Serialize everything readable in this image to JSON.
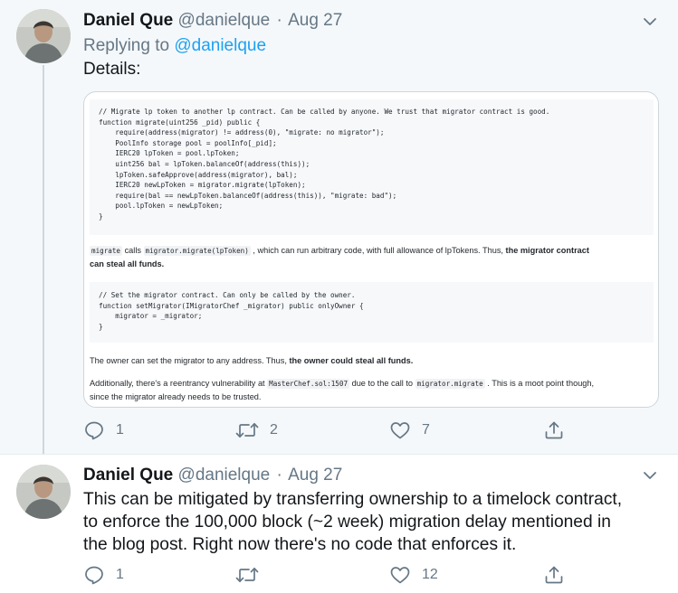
{
  "tweets": [
    {
      "name": "Daniel Que",
      "handle": "@danielque",
      "separator": "·",
      "date": "Aug 27",
      "replying_prefix": "Replying to",
      "replying_to": "@danielque",
      "text": "Details:",
      "image": {
        "code_block_1": [
          "// Migrate lp token to another lp contract. Can be called by anyone. We trust that migrator contract is good.",
          "function migrate(uint256 _pid) public {",
          "    require(address(migrator) != address(0), \"migrate: no migrator\");",
          "    PoolInfo storage pool = poolInfo[_pid];",
          "    IERC20 lpToken = pool.lpToken;",
          "    uint256 bal = lpToken.balanceOf(address(this));",
          "    lpToken.safeApprove(address(migrator), bal);",
          "    IERC20 newLpToken = migrator.migrate(lpToken);",
          "    require(bal == newLpToken.balanceOf(address(this)), \"migrate: bad\");",
          "    pool.lpToken = newLpToken;",
          "}"
        ],
        "para_1": {
          "code_a": "migrate",
          "text_a": " calls ",
          "code_b": "migrator.migrate(lpToken)",
          "text_b": " , which can run arbitrary code, with full allowance of lpTokens. Thus, ",
          "bold_line1": "the migrator contract",
          "bold_line2": "can steal all funds."
        },
        "code_block_2": [
          "// Set the migrator contract. Can only be called by the owner.",
          "function setMigrator(IMigratorChef _migrator) public onlyOwner {",
          "    migrator = _migrator;",
          "}"
        ],
        "para_2": {
          "text": "The owner can set the migrator to any address. Thus, ",
          "bold": "the owner could steal all funds."
        },
        "para_3": {
          "text_a": "Additionally, there's a reentrancy vulnerability at ",
          "code_a": "MasterChef.sol:1507",
          "text_b": " due to the call to ",
          "code_b": "migrator.migrate",
          "text_c": " . This is a moot point though,",
          "line2": "since the migrator already needs to be trusted."
        }
      },
      "actions": {
        "replies": "1",
        "retweets": "2",
        "likes": "7"
      }
    },
    {
      "name": "Daniel Que",
      "handle": "@danielque",
      "separator": "·",
      "date": "Aug 27",
      "text_lines": [
        "This can be mitigated by transferring ownership to a timelock contract,",
        "to enforce the 100,000 block (~2 week) migration delay mentioned in",
        "the blog post. Right now there's no code that enforces it."
      ],
      "actions": {
        "replies": "1",
        "retweets": "",
        "likes": "12"
      }
    }
  ],
  "icons": [
    "reply-icon",
    "retweet-icon",
    "like-icon",
    "share-icon",
    "chevron-down-icon"
  ],
  "colors": {
    "accent": "#1da1f2",
    "secondary_text": "#657786",
    "highlight_bg": "#f5f8fa",
    "thread_line": "#ccd6dd"
  }
}
